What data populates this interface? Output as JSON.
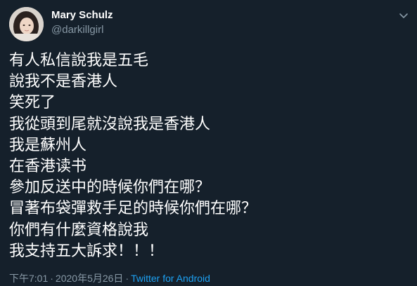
{
  "author": {
    "display_name": "Mary Schulz",
    "handle": "@darkillgirl"
  },
  "tweet": {
    "lines": [
      "有人私信說我是五毛",
      "說我不是香港人",
      "笑死了",
      "我從頭到尾就沒說我是香港人",
      "我是蘇州人",
      "在香港读书",
      "參加反送中的時候你們在哪？",
      "冒著布袋彈救手足的時候你們在哪？",
      "你們有什麼資格說我",
      "我支持五大訴求！！！"
    ]
  },
  "meta": {
    "time": "下午7:01",
    "separator": "·",
    "date": "2020年5月26日",
    "source": "Twitter for Android"
  },
  "icons": {
    "more": "chevron-down-icon"
  },
  "colors": {
    "background": "#15202b",
    "text": "#ffffff",
    "secondary": "#8899a6",
    "link": "#1da1f2"
  }
}
